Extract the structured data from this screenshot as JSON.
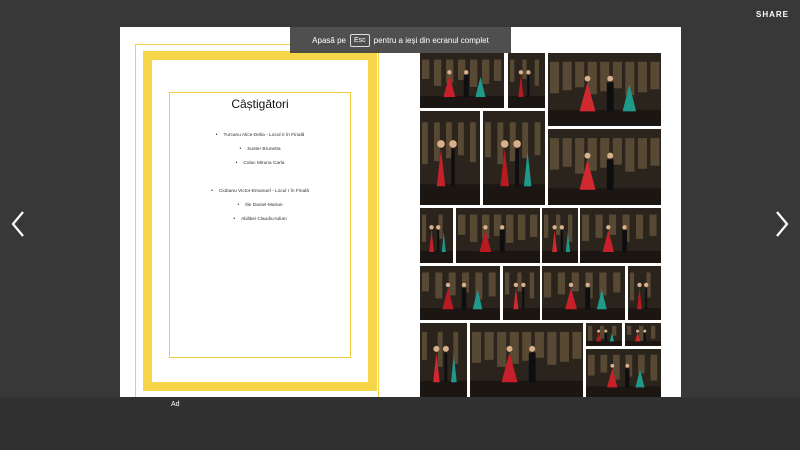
{
  "toolbar": {
    "share_label": "SHARE"
  },
  "navigation": {
    "prev_icon": "chevron-left-icon",
    "next_icon": "chevron-right-icon"
  },
  "page": {
    "title": "Câștigători",
    "winners_group_1": [
      "Turcanu Alice-Delia - Locul II în Finală",
      "Suster Brunetta",
      "Colac Miruna Carla"
    ],
    "winners_group_2": [
      "Ciobanu Victor-Emanuel - Locul I în Finală",
      "Ilie Daniel-Marian",
      "Abăbei Claudiu-Iulian"
    ],
    "frame_color": "#f5d648"
  },
  "fullscreen_notice": {
    "before": "Apasă pe",
    "key": "Esc",
    "after": "pentru a ieși din ecranul complet"
  },
  "footer": {
    "ad_label": "Ad"
  },
  "colors": {
    "background": "#383838",
    "bottom_bar": "#313131",
    "page": "#ffffff",
    "dress_red": "#c8202a",
    "dress_teal": "#1f9a8a"
  }
}
